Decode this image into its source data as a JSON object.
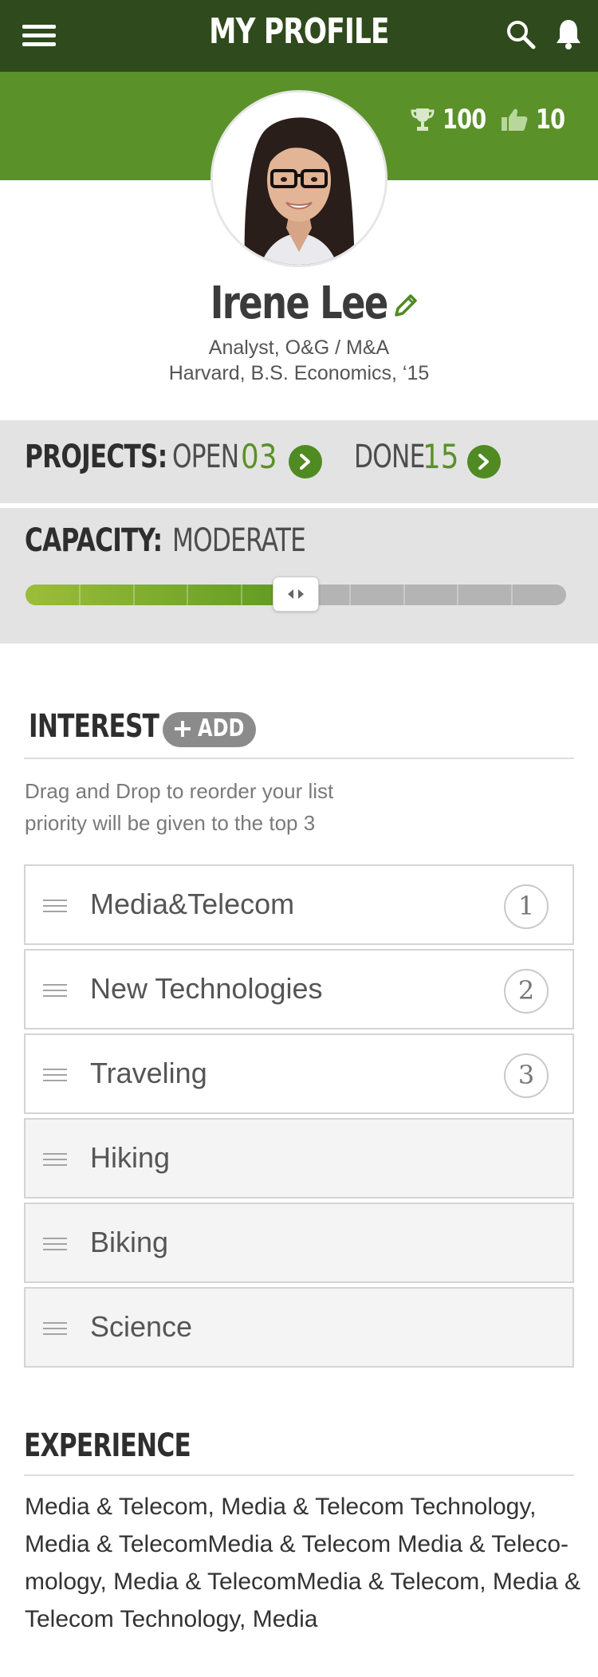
{
  "header": {
    "title": "MY PROFILE",
    "icons": [
      "menu-icon",
      "search-icon",
      "bell-icon"
    ]
  },
  "stats": {
    "trophy_count": "100",
    "likes_count": "10"
  },
  "profile": {
    "name": "Irene Lee",
    "role": "Analyst, O&G / M&A",
    "education": "Harvard, B.S. Economics, ‘15"
  },
  "projects": {
    "label": "PROJECTS:",
    "open_label": "OPEN",
    "open_count": "03",
    "done_label": "DONE",
    "done_count": "15"
  },
  "capacity": {
    "label": "CAPACITY:",
    "value": "MODERATE",
    "level_fraction": 0.5,
    "segments": 10
  },
  "interest": {
    "title": "INTEREST",
    "add_label": "ADD",
    "hint_line1": "Drag and Drop to reorder your list",
    "hint_line2": "priority will be given to the top 3",
    "items": [
      {
        "label": "Media&Telecom",
        "rank": "1"
      },
      {
        "label": "New Technologies",
        "rank": "2"
      },
      {
        "label": "Traveling",
        "rank": "3"
      },
      {
        "label": "Hiking",
        "rank": ""
      },
      {
        "label": "Biking",
        "rank": ""
      },
      {
        "label": "Science",
        "rank": ""
      }
    ]
  },
  "experience": {
    "title": "EXPERIENCE",
    "text": "Media & Telecom, Media & Telecom Technology, Media & TelecomMedia & Telecom Media & Teleco-mology, Media & TelecomMedia & Telecom, Media & Telecom Technology, Media"
  },
  "colors": {
    "header_bg": "#2f4a1c",
    "brand_green": "#5a9128",
    "panel_gray": "#e3e3e3"
  }
}
